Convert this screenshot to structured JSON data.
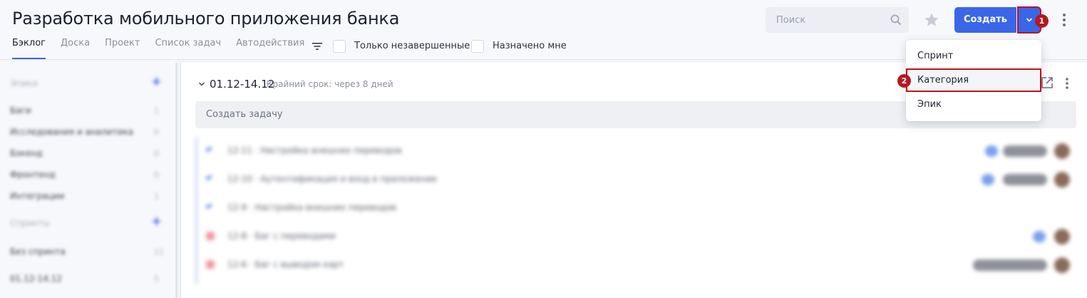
{
  "header": {
    "title": "Разработка мобильного приложения банка",
    "tabs": [
      {
        "label": "Бэклог",
        "active": true
      },
      {
        "label": "Доска"
      },
      {
        "label": "Проект"
      },
      {
        "label": "Список задач"
      },
      {
        "label": "Автодействия"
      }
    ],
    "filters": {
      "only_unfinished": "Только незавершенные",
      "assigned_to_me": "Назначено мне"
    },
    "search_placeholder": "Поиск",
    "create_label": "Создать",
    "markers": [
      "1",
      "2"
    ]
  },
  "dropdown": {
    "items": [
      {
        "label": "Спринт"
      },
      {
        "label": "Категория",
        "highlighted": true
      },
      {
        "label": "Эпик"
      }
    ]
  },
  "sidebar": {
    "sections": [
      {
        "title": "Эпики",
        "items": [
          {
            "label": "Баги",
            "count": "1"
          },
          {
            "label": "Исследования и аналитика",
            "count": "0"
          },
          {
            "label": "Бэкенд",
            "count": "0"
          },
          {
            "label": "Фронтенд",
            "count": "0"
          },
          {
            "label": "Интеграции",
            "count": "1"
          }
        ]
      },
      {
        "title": "Спринты",
        "items": [
          {
            "label": "Без спринта",
            "count": "11"
          },
          {
            "label": "01.12-14.12",
            "count": "5"
          }
        ]
      }
    ]
  },
  "main": {
    "sprint_name": "01.12-14.12",
    "sprint_due": "Крайний срок: через 8 дней",
    "create_task_label": "Создать задачу",
    "tasks": [
      {
        "type": "story",
        "text": "12-11 · Настройка внешних переводов"
      },
      {
        "type": "story",
        "text": "12-10 · Аутентификация и вход в приложение"
      },
      {
        "type": "story",
        "text": "12-9 · Настройка внешних переводов"
      },
      {
        "type": "bug",
        "text": "12-8 · Баг с переводами"
      },
      {
        "type": "bug",
        "text": "12-6 · Баг с выводом карт"
      }
    ]
  },
  "colors": {
    "accent": "#3a66e8",
    "highlight": "#c0121a"
  }
}
